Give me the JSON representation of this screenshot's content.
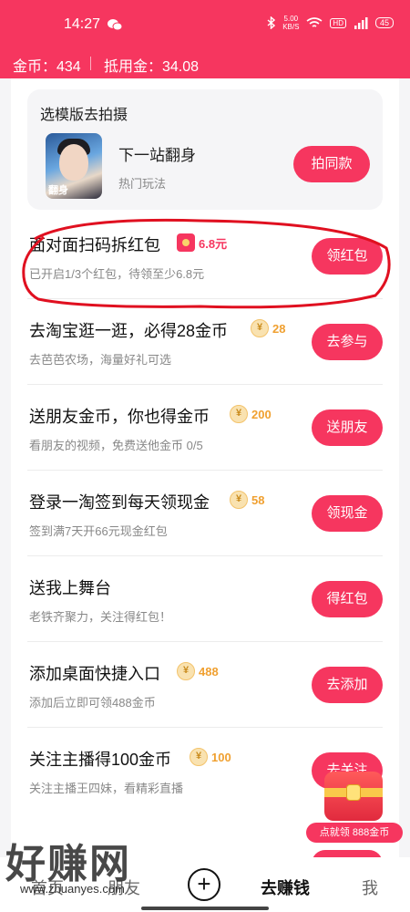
{
  "status": {
    "time": "14:27",
    "speed_value": "5.00",
    "speed_unit": "KB/S",
    "hd": "HD",
    "battery": "45"
  },
  "header": {
    "coins": "金币：434",
    "deduct": "抵用金：34.08"
  },
  "template": {
    "title": "选模版去拍摄",
    "name": "下一站翻身",
    "sub": "热门玩法",
    "button": "拍同款",
    "thumb_text": "翻身"
  },
  "tasks": [
    {
      "title": "面对面扫码拆红包",
      "reward": "6.8元",
      "desc": "已开启1/3个红包，待领至少6.8元",
      "button": "领红包"
    },
    {
      "title": "去淘宝逛一逛，必得28金币",
      "reward": "28",
      "desc": "去芭芭农场，海量好礼可选",
      "button": "去参与"
    },
    {
      "title": "送朋友金币，你也得金币",
      "reward": "200",
      "desc": "看朋友的视频，免费送他金币 0/5",
      "button": "送朋友"
    },
    {
      "title": "登录一淘签到每天领现金",
      "reward": "58",
      "desc": "签到满7天开66元现金红包",
      "button": "领现金"
    },
    {
      "title": "送我上舞台",
      "desc": "老铁齐聚力，关注得红包！",
      "button": "得红包"
    },
    {
      "title": "添加桌面快捷入口",
      "reward": "488",
      "desc": "添加后立即可领488金币",
      "button": "去添加"
    },
    {
      "title": "关注主播得100金币",
      "reward": "100",
      "desc": "关注主播王四妹，看精彩直播",
      "button": "去关注"
    }
  ],
  "coin_symbol": "¥",
  "promo": {
    "label": "点就领 888金币"
  },
  "tabbar": {
    "tab1": "首页",
    "tab2": "朋友",
    "add": "+",
    "tab3": "去赚钱",
    "tab4": "我"
  },
  "watermark": {
    "big": "好赚网",
    "url": "www.zhuanyes.com"
  },
  "colors": {
    "accent": "#f6365f",
    "coin": "#f0a030"
  }
}
